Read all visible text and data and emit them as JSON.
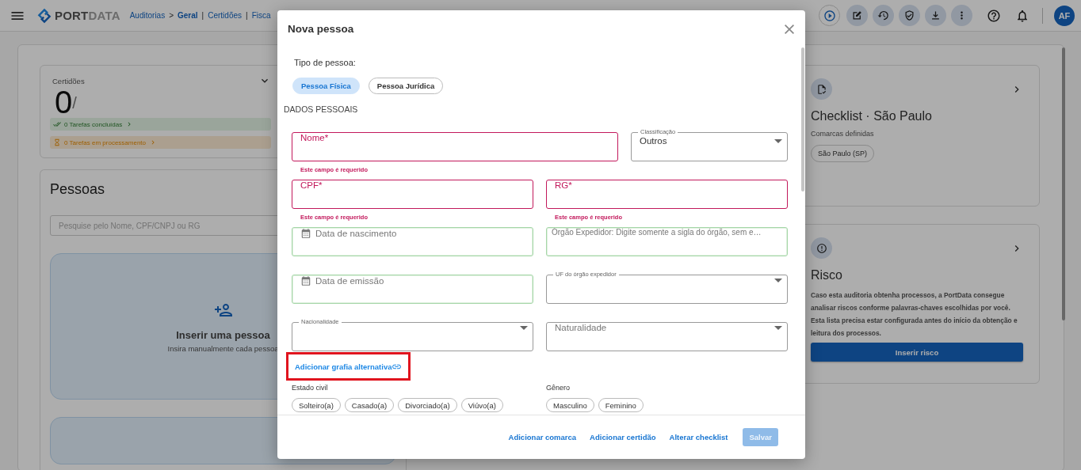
{
  "header": {
    "logo": "**PORT**DATA",
    "breadcrumb": [
      {
        "label": "Auditorias",
        "kind": "link"
      },
      {
        "label": ">",
        "kind": "separator"
      },
      {
        "label": "Geral",
        "kind": "current"
      },
      {
        "label": "|",
        "kind": "separator"
      },
      {
        "label": "Certidões",
        "kind": "link"
      },
      {
        "label": "|",
        "kind": "separator"
      },
      {
        "label": "Fisca",
        "kind": "link"
      }
    ],
    "avatar": "AF"
  },
  "certidoes": {
    "label": "Certidões",
    "count": "0",
    "separator": "/",
    "tasks": [
      {
        "label": "0 Tarefas concluídas",
        "kind": "done"
      },
      {
        "label": "0 Tarefas em processamento",
        "kind": "processing"
      }
    ]
  },
  "pessoas": {
    "title": "Pessoas",
    "search": {
      "placeholder": "Pesquise pelo Nome, CPF/CNPJ ou RG"
    },
    "insert_card": {
      "title": "Inserir uma pessoa",
      "subtitle": "Insira manualmente cada pessoa"
    }
  },
  "checklist": {
    "title": "Checklist · São Paulo",
    "subtitle": "Comarcas definidas",
    "chips": [
      "São Paulo (SP)"
    ]
  },
  "risco": {
    "title": "Risco",
    "description": "Caso esta auditoria obtenha processos, a PortData consegue analisar riscos conforme palavras-chaves escolhidas por você. Esta lista precisa estar configurada antes do início da obtenção e leitura dos processos.",
    "button": "Inserir risco"
  },
  "modal": {
    "title": "Nova pessoa",
    "person_type_label": "Tipo de pessoa:",
    "person_types": [
      {
        "label": "Pessoa Física",
        "selected": true
      },
      {
        "label": "Pessoa Jurídica",
        "selected": false
      }
    ],
    "section_title": "DADOS PESSOAIS",
    "field_rows": [
      [
        {
          "kind": "text",
          "placeholder": "Nome*",
          "invalid": true,
          "valid": false,
          "error": "Este campo é requerido",
          "wide": true
        },
        {
          "kind": "select",
          "label": "Classificação",
          "value": "Outros",
          "invalid": false,
          "valid": false
        }
      ],
      [
        {
          "kind": "text",
          "placeholder": "CPF*",
          "invalid": true,
          "valid": false,
          "error": "Este campo é requerido"
        },
        {
          "kind": "text",
          "placeholder": "RG*",
          "invalid": true,
          "valid": false,
          "error": "Este campo é requerido"
        }
      ],
      [
        {
          "kind": "date",
          "placeholder": "Data de nascimento",
          "invalid": false,
          "valid": true
        },
        {
          "kind": "text",
          "placeholder": "Órgão Expedidor: Digite somente a sigla do órgão, sem e…",
          "invalid": false,
          "valid": true
        }
      ],
      [
        {
          "kind": "date",
          "placeholder": "Data de emissão",
          "invalid": false,
          "valid": true
        },
        {
          "kind": "select",
          "label": "UF do órgão expedidor",
          "invalid": false,
          "valid": false
        }
      ],
      [
        {
          "kind": "select",
          "label": "Nacionalidade",
          "invalid": false,
          "valid": false
        },
        {
          "kind": "select",
          "placeholder": "Naturalidade",
          "invalid": false,
          "valid": false
        }
      ]
    ],
    "alt_link": {
      "label": "Adicionar grafia alternativa",
      "highlighted": true
    },
    "groups": [
      {
        "label": "Estado civil",
        "options": [
          {
            "label": "Solteiro(a)",
            "selected": false
          },
          {
            "label": "Casado(a)",
            "selected": false
          },
          {
            "label": "Divorciado(a)",
            "selected": false
          },
          {
            "label": "Viúvo(a)",
            "selected": false
          }
        ]
      },
      {
        "label": "Gênero",
        "options": [
          {
            "label": "Masculino",
            "selected": false
          },
          {
            "label": "Feminino",
            "selected": false
          }
        ]
      }
    ],
    "footer": {
      "links": [
        "Adicionar comarca",
        "Adicionar certidão",
        "Alterar checklist"
      ],
      "save": {
        "label": "Salvar",
        "disabled": true
      }
    }
  }
}
